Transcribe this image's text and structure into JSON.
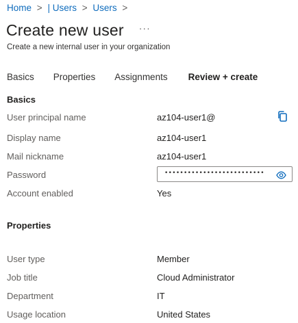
{
  "breadcrumb": {
    "items": [
      "Home",
      "| Users",
      "Users"
    ],
    "separator": ">"
  },
  "header": {
    "title": "Create new user",
    "more_label": "···",
    "subtitle": "Create a new internal user in your organization"
  },
  "tabs": [
    {
      "label": "Basics",
      "active": false
    },
    {
      "label": "Properties",
      "active": false
    },
    {
      "label": "Assignments",
      "active": false
    },
    {
      "label": "Review + create",
      "active": true
    }
  ],
  "basics": {
    "heading": "Basics",
    "fields": [
      {
        "label": "User principal name",
        "value": "az104-user1@"
      },
      {
        "label": "Display name",
        "value": "az104-user1"
      },
      {
        "label": "Mail nickname",
        "value": "az104-user1"
      },
      {
        "label": "Password",
        "value": "••••••••••••••••••••••••••"
      },
      {
        "label": "Account enabled",
        "value": "Yes"
      }
    ]
  },
  "properties": {
    "heading": "Properties",
    "fields": [
      {
        "label": "User type",
        "value": "Member"
      },
      {
        "label": "Job title",
        "value": "Cloud Administrator"
      },
      {
        "label": "Department",
        "value": "IT"
      },
      {
        "label": "Usage location",
        "value": "United States"
      }
    ]
  },
  "icons": {
    "copy": "copy-icon",
    "eye": "eye-icon",
    "more": "more-icon"
  },
  "colors": {
    "accent": "#0f6cbd",
    "text": "#323130",
    "label": "#605e5c"
  }
}
